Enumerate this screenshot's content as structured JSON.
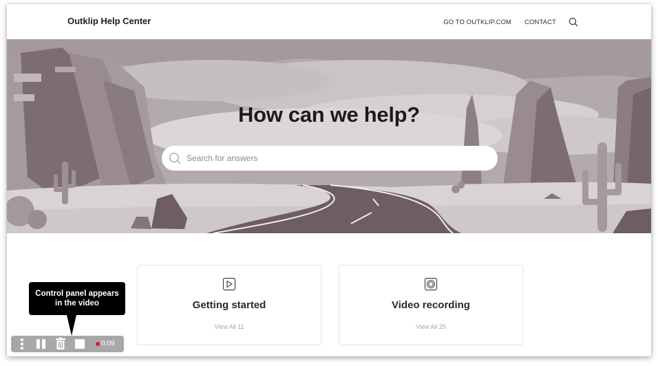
{
  "header": {
    "brand": "Outklip Help Center",
    "nav": [
      {
        "label": "GO TO OUTKLIP.COM"
      },
      {
        "label": "CONTACT"
      }
    ],
    "search_icon": "search-icon"
  },
  "hero": {
    "title": "How can we help?",
    "search": {
      "placeholder": "Search for answers",
      "value": ""
    },
    "illustration": "desert-canyon-road-illustration"
  },
  "categories": [
    {
      "icon": "play-icon",
      "title": "Getting started",
      "link": "View All 11"
    },
    {
      "icon": "record-icon",
      "title": "Video recording",
      "link": "View All 25"
    }
  ],
  "tooltip": {
    "text_line1": "Control panel appears",
    "text_line2": "in the video"
  },
  "control_panel": {
    "buttons": [
      "more-icon",
      "pause-icon",
      "trash-icon",
      "stop-icon"
    ],
    "recording_indicator_color": "#d0212e",
    "elapsed_time": "0:09"
  },
  "colors": {
    "hero_tint": "#b4abae",
    "rock_dark": "#7d6c72",
    "road": "#6e5d63"
  }
}
